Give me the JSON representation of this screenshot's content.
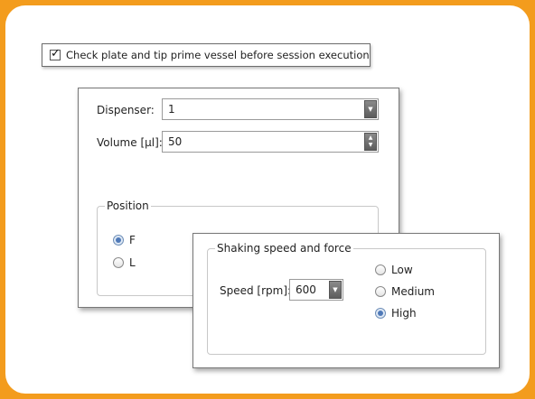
{
  "check": {
    "label": "Check plate and tip prime vessel before session execution",
    "checked": true
  },
  "dispenser": {
    "label": "Dispenser:",
    "value": "1"
  },
  "volume": {
    "label": "Volume [µl]:",
    "value": "50"
  },
  "position": {
    "title": "Position",
    "options": [
      {
        "label": "F",
        "selected": true
      },
      {
        "label": "L",
        "selected": false
      }
    ]
  },
  "shaking": {
    "title": "Shaking speed and force",
    "speed_label": "Speed [rpm]:",
    "speed_value": "600",
    "force_options": [
      {
        "label": "Low",
        "selected": false
      },
      {
        "label": "Medium",
        "selected": false
      },
      {
        "label": "High",
        "selected": true
      }
    ]
  },
  "colors": {
    "frame": "#f39c1d",
    "radio_selected": "#4f79b8"
  }
}
